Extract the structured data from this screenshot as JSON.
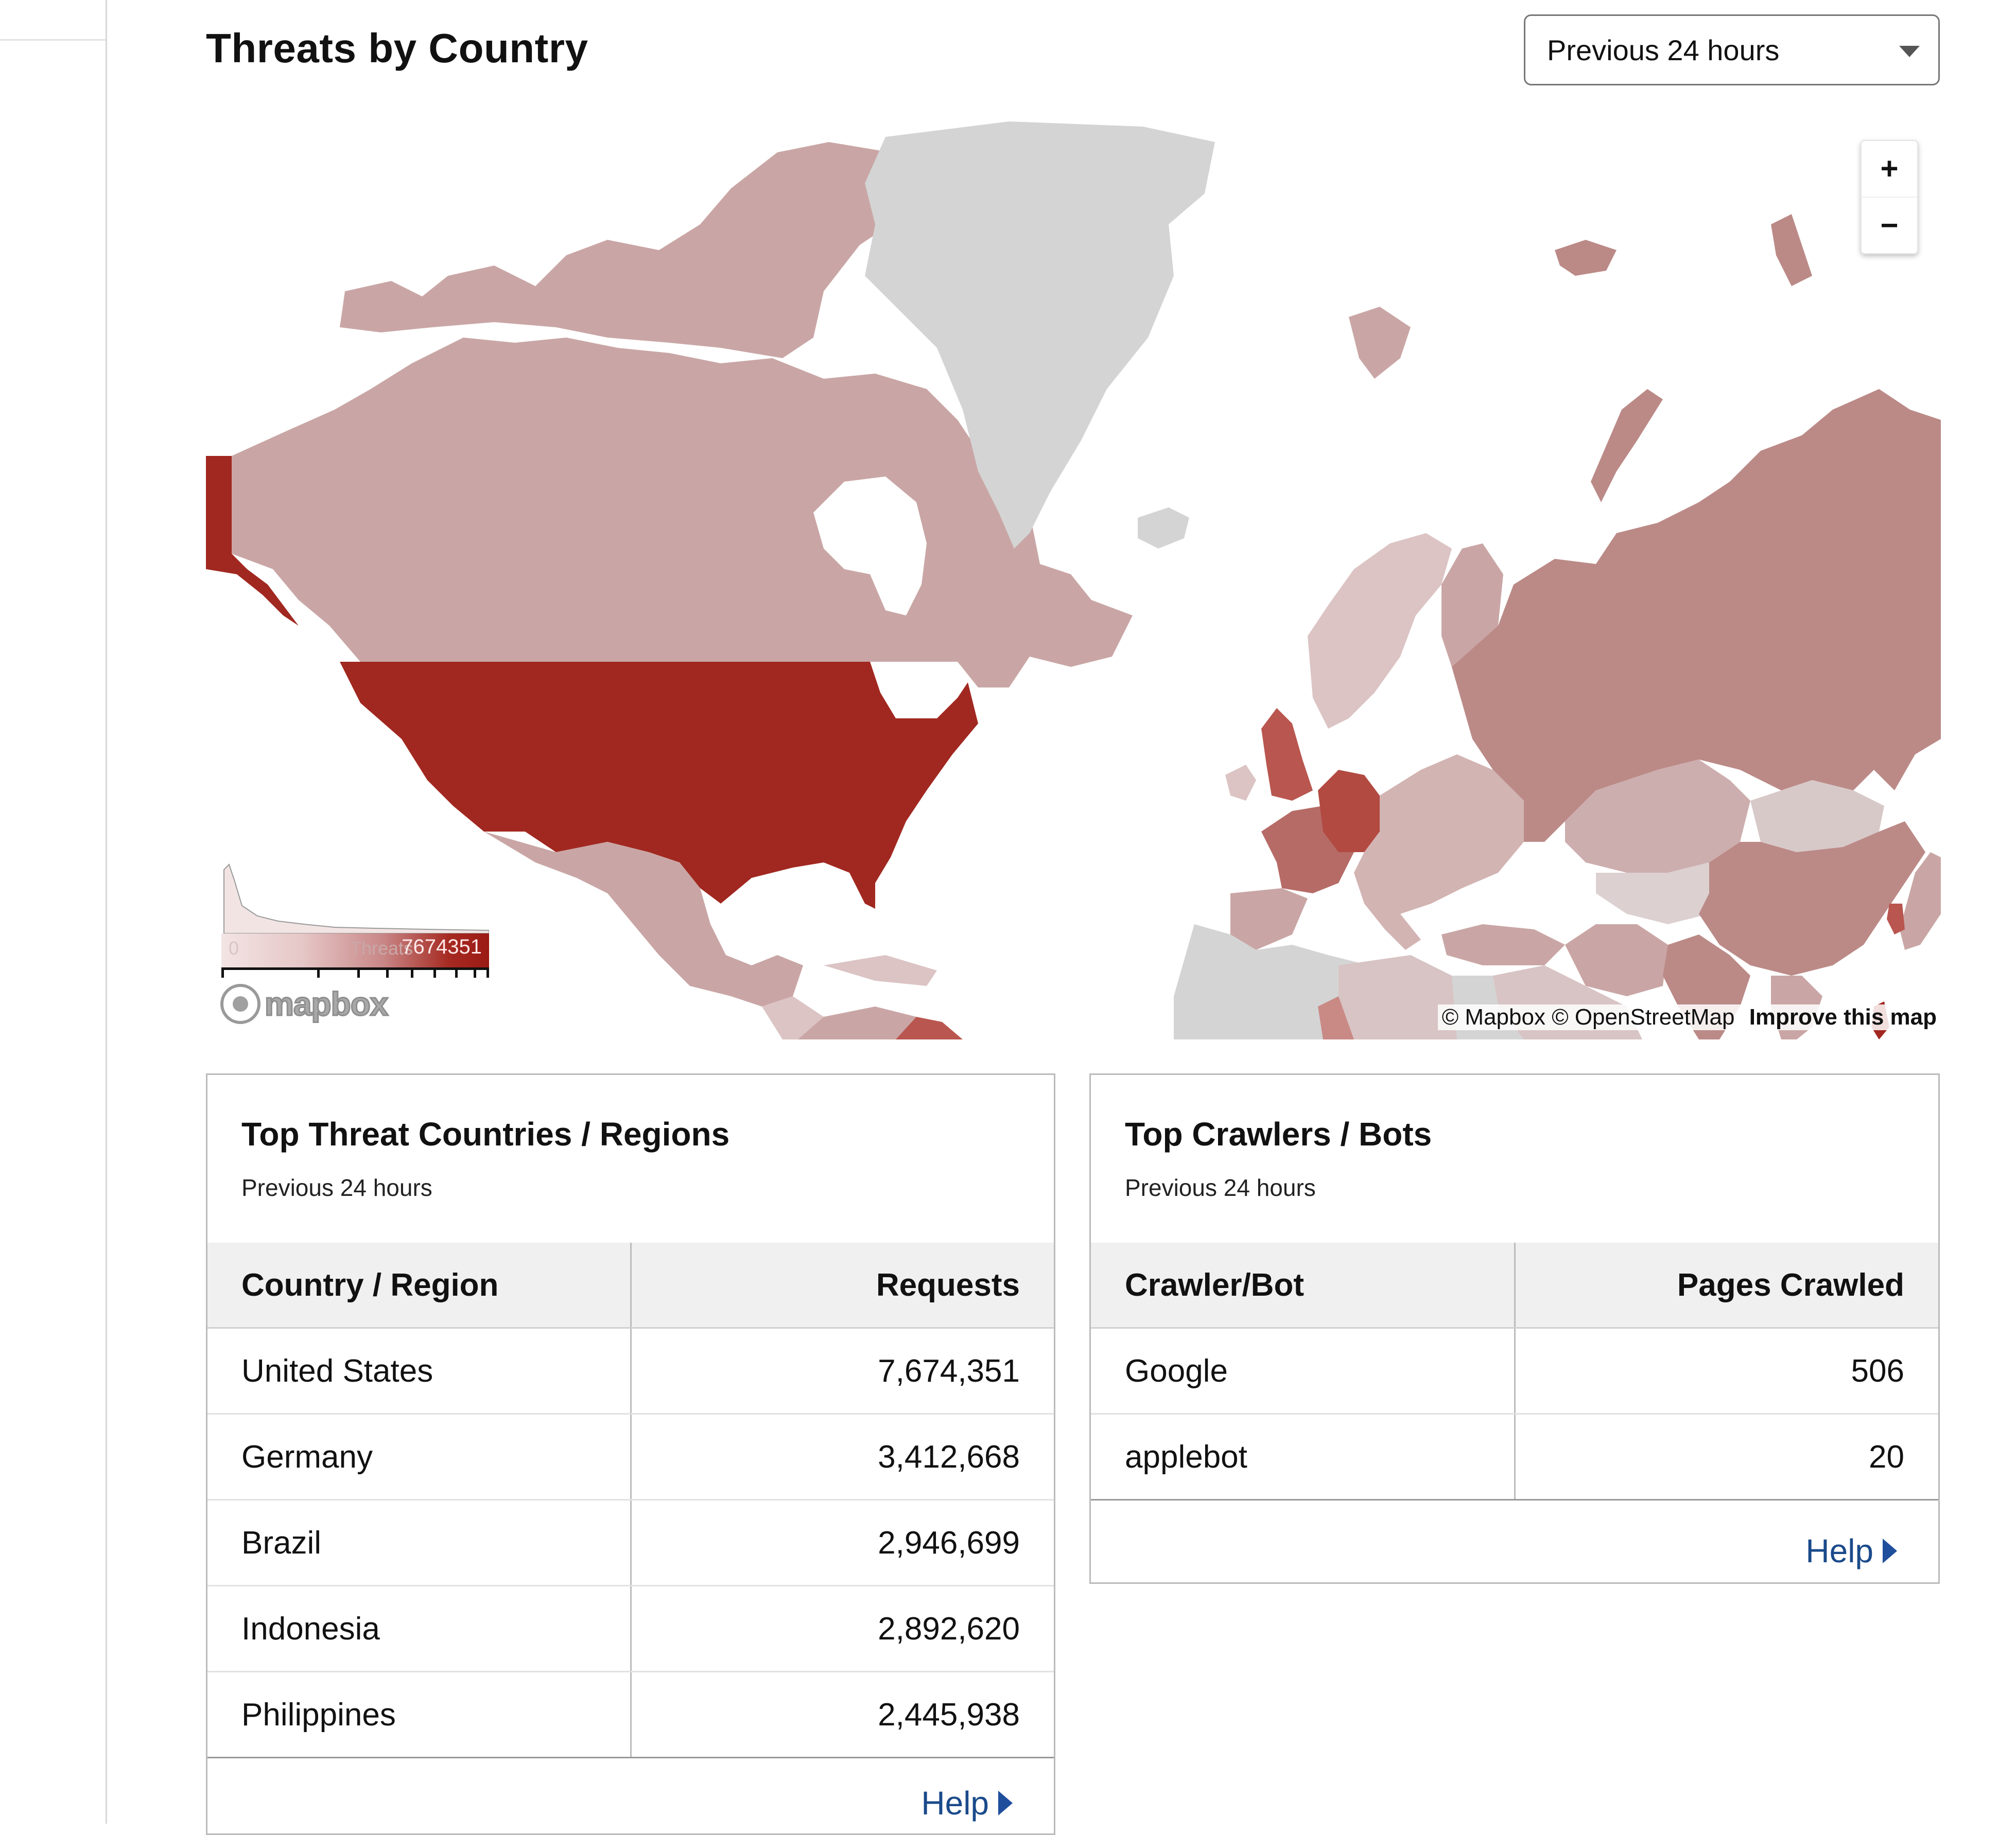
{
  "header": {
    "title": "Threats by Country",
    "time_range": {
      "selected": "Previous 24 hours"
    }
  },
  "map": {
    "legend": {
      "metric_label": "Threats",
      "min": "0",
      "max": "7674351",
      "color_low": "#f3e4e4",
      "color_high": "#9b1a14"
    },
    "zoom_in_label": "+",
    "zoom_out_label": "−",
    "attribution": {
      "mapbox": "© Mapbox",
      "osm": "© OpenStreetMap",
      "improve": "Improve this map"
    },
    "logo_text": "mapbox",
    "colors": {
      "no_data": "#d4d4d4",
      "tier_very_high": "#a12820",
      "tier_high": "#b9564f",
      "tier_medium": "#bb8a87",
      "tier_low": "#c9a6a5",
      "tier_very_low": "#dcc4c4"
    },
    "highlighted_countries": [
      {
        "name": "United States",
        "tier": "very_high"
      },
      {
        "name": "Germany",
        "tier": "high"
      },
      {
        "name": "France",
        "tier": "medium_high"
      },
      {
        "name": "Russia",
        "tier": "medium"
      },
      {
        "name": "China",
        "tier": "medium"
      },
      {
        "name": "India",
        "tier": "medium"
      },
      {
        "name": "Canada",
        "tier": "low"
      },
      {
        "name": "Greenland",
        "tier": "no_data"
      }
    ]
  },
  "threat_countries": {
    "title": "Top Threat Countries / Regions",
    "subtitle": "Previous 24 hours",
    "columns": [
      "Country / Region",
      "Requests"
    ],
    "rows": [
      {
        "country": "United States",
        "requests": "7,674,351"
      },
      {
        "country": "Germany",
        "requests": "3,412,668"
      },
      {
        "country": "Brazil",
        "requests": "2,946,699"
      },
      {
        "country": "Indonesia",
        "requests": "2,892,620"
      },
      {
        "country": "Philippines",
        "requests": "2,445,938"
      }
    ],
    "help_label": "Help"
  },
  "crawlers": {
    "title": "Top Crawlers / Bots",
    "subtitle": "Previous 24 hours",
    "columns": [
      "Crawler/Bot",
      "Pages Crawled"
    ],
    "rows": [
      {
        "bot": "Google",
        "pages": "506"
      },
      {
        "bot": "applebot",
        "pages": "20"
      }
    ],
    "help_label": "Help"
  }
}
